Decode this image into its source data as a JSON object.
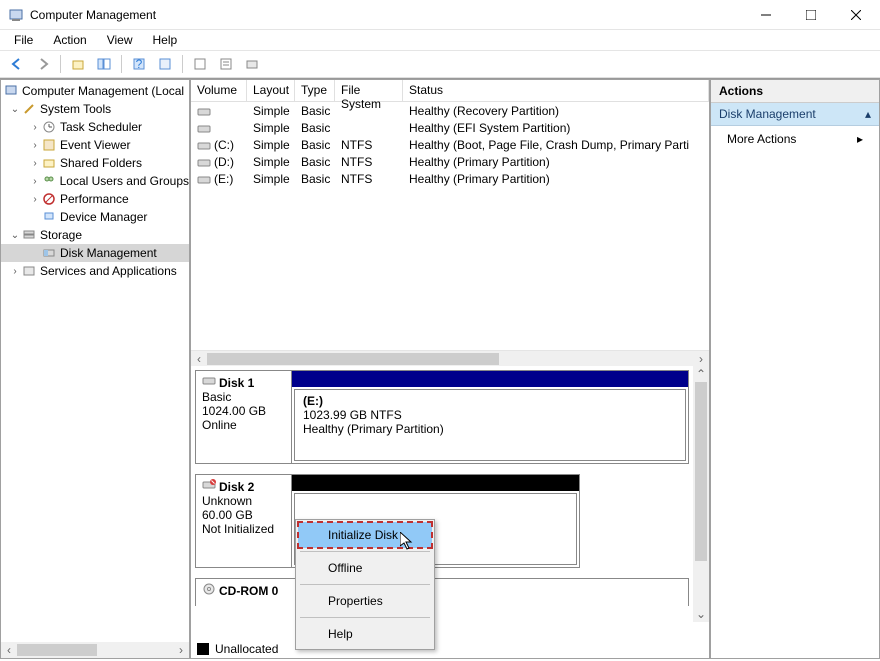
{
  "window": {
    "title": "Computer Management"
  },
  "menu": {
    "file": "File",
    "action": "Action",
    "view": "View",
    "help": "Help"
  },
  "tree": {
    "root": "Computer Management (Local",
    "system_tools": "System Tools",
    "task_scheduler": "Task Scheduler",
    "event_viewer": "Event Viewer",
    "shared_folders": "Shared Folders",
    "local_users": "Local Users and Groups",
    "performance": "Performance",
    "device_manager": "Device Manager",
    "storage": "Storage",
    "disk_management": "Disk Management",
    "services": "Services and Applications"
  },
  "volumes": {
    "headers": {
      "volume": "Volume",
      "layout": "Layout",
      "type": "Type",
      "fs": "File System",
      "status": "Status"
    },
    "rows": [
      {
        "volume": "",
        "layout": "Simple",
        "type": "Basic",
        "fs": "",
        "status": "Healthy (Recovery Partition)"
      },
      {
        "volume": "",
        "layout": "Simple",
        "type": "Basic",
        "fs": "",
        "status": "Healthy (EFI System Partition)"
      },
      {
        "volume": "(C:)",
        "layout": "Simple",
        "type": "Basic",
        "fs": "NTFS",
        "status": "Healthy (Boot, Page File, Crash Dump, Primary Parti"
      },
      {
        "volume": "(D:)",
        "layout": "Simple",
        "type": "Basic",
        "fs": "NTFS",
        "status": "Healthy (Primary Partition)"
      },
      {
        "volume": "(E:)",
        "layout": "Simple",
        "type": "Basic",
        "fs": "NTFS",
        "status": "Healthy (Primary Partition)"
      }
    ]
  },
  "disks": {
    "disk1": {
      "name": "Disk 1",
      "type": "Basic",
      "size": "1024.00 GB",
      "state": "Online",
      "part": {
        "letter": "(E:)",
        "size": "1023.99 GB NTFS",
        "status": "Healthy (Primary Partition)"
      }
    },
    "disk2": {
      "name": "Disk 2",
      "type": "Unknown",
      "size": "60.00 GB",
      "state": "Not Initialized"
    },
    "cdrom": {
      "name": "CD-ROM 0"
    }
  },
  "legend": {
    "unallocated": "Unallocated"
  },
  "actions": {
    "header": "Actions",
    "section": "Disk Management",
    "more": "More Actions"
  },
  "context": {
    "initialize": "Initialize Disk",
    "offline": "Offline",
    "properties": "Properties",
    "help": "Help"
  }
}
